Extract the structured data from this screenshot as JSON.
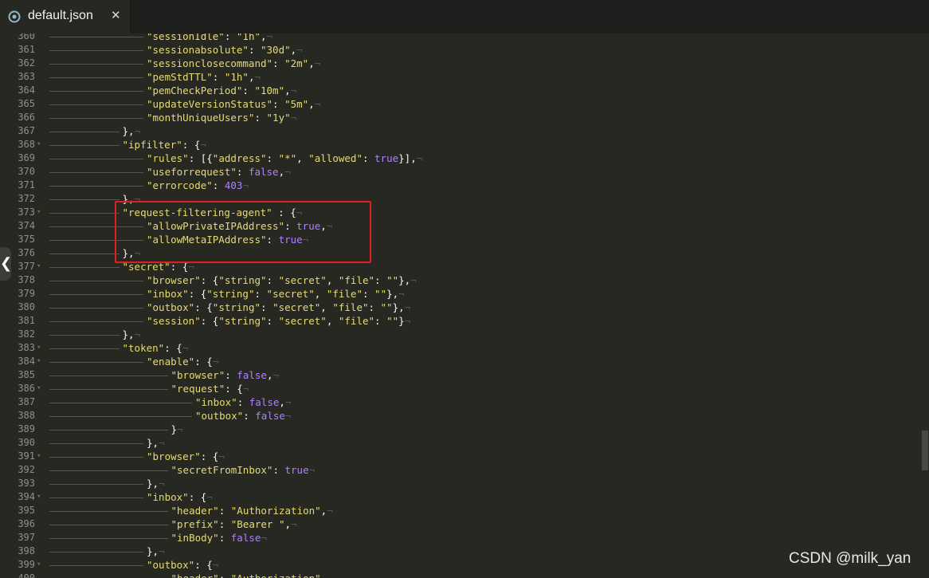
{
  "tab": {
    "title": "default.json",
    "close": "✕",
    "icon": "file-json-icon"
  },
  "collapse_handle": "❮",
  "watermark": "CSDN @milk_yan",
  "colors": {
    "background": "#272822",
    "key": "#e6db74",
    "number_bool": "#ae81ff",
    "punct": "#f8f8f2",
    "line_number": "#8f908a",
    "highlight": "#e02020"
  },
  "lines": [
    {
      "n": "360",
      "fold": false,
      "indent": 4,
      "t": [
        [
          "k",
          "\"sessionIdle\""
        ],
        [
          "p",
          ": "
        ],
        [
          "k",
          "\"1h\""
        ],
        [
          "p",
          ","
        ]
      ]
    },
    {
      "n": "361",
      "fold": false,
      "indent": 4,
      "t": [
        [
          "k",
          "\"sessionabsolute\""
        ],
        [
          "p",
          ": "
        ],
        [
          "k",
          "\"30d\""
        ],
        [
          "p",
          ","
        ]
      ]
    },
    {
      "n": "362",
      "fold": false,
      "indent": 4,
      "t": [
        [
          "k",
          "\"sessionclosecommand\""
        ],
        [
          "p",
          ": "
        ],
        [
          "k",
          "\"2m\""
        ],
        [
          "p",
          ","
        ]
      ]
    },
    {
      "n": "363",
      "fold": false,
      "indent": 4,
      "t": [
        [
          "k",
          "\"pemStdTTL\""
        ],
        [
          "p",
          ": "
        ],
        [
          "k",
          "\"1h\""
        ],
        [
          "p",
          ","
        ]
      ]
    },
    {
      "n": "364",
      "fold": false,
      "indent": 4,
      "t": [
        [
          "k",
          "\"pemCheckPeriod\""
        ],
        [
          "p",
          ": "
        ],
        [
          "k",
          "\"10m\""
        ],
        [
          "p",
          ","
        ]
      ]
    },
    {
      "n": "365",
      "fold": false,
      "indent": 4,
      "t": [
        [
          "k",
          "\"updateVersionStatus\""
        ],
        [
          "p",
          ": "
        ],
        [
          "k",
          "\"5m\""
        ],
        [
          "p",
          ","
        ]
      ]
    },
    {
      "n": "366",
      "fold": false,
      "indent": 4,
      "t": [
        [
          "k",
          "\"monthUniqueUsers\""
        ],
        [
          "p",
          ": "
        ],
        [
          "k",
          "\"1y\""
        ]
      ]
    },
    {
      "n": "367",
      "fold": false,
      "indent": 3,
      "t": [
        [
          "p",
          "},"
        ]
      ]
    },
    {
      "n": "368",
      "fold": true,
      "indent": 3,
      "t": [
        [
          "k",
          "\"ipfilter\""
        ],
        [
          "p",
          ": {"
        ]
      ]
    },
    {
      "n": "369",
      "fold": false,
      "indent": 4,
      "t": [
        [
          "k",
          "\"rules\""
        ],
        [
          "p",
          ": [{"
        ],
        [
          "k",
          "\"address\""
        ],
        [
          "p",
          ": "
        ],
        [
          "k",
          "\"*\""
        ],
        [
          "p",
          ", "
        ],
        [
          "k",
          "\"allowed\""
        ],
        [
          "p",
          ": "
        ],
        [
          "n",
          "true"
        ],
        [
          "p",
          "}],"
        ]
      ]
    },
    {
      "n": "370",
      "fold": false,
      "indent": 4,
      "t": [
        [
          "k",
          "\"useforrequest\""
        ],
        [
          "p",
          ": "
        ],
        [
          "n",
          "false"
        ],
        [
          "p",
          ","
        ]
      ]
    },
    {
      "n": "371",
      "fold": false,
      "indent": 4,
      "t": [
        [
          "k",
          "\"errorcode\""
        ],
        [
          "p",
          ": "
        ],
        [
          "n",
          "403"
        ]
      ]
    },
    {
      "n": "372",
      "fold": false,
      "indent": 3,
      "t": [
        [
          "p",
          "},"
        ]
      ]
    },
    {
      "n": "373",
      "fold": true,
      "indent": 3,
      "t": [
        [
          "k",
          "\"request-filtering-agent\""
        ],
        [
          "p",
          " : {"
        ]
      ]
    },
    {
      "n": "374",
      "fold": false,
      "indent": 4,
      "t": [
        [
          "k",
          "\"allowPrivateIPAddress\""
        ],
        [
          "p",
          ": "
        ],
        [
          "n",
          "true"
        ],
        [
          "p",
          ","
        ]
      ]
    },
    {
      "n": "375",
      "fold": false,
      "indent": 4,
      "t": [
        [
          "k",
          "\"allowMetaIPAddress\""
        ],
        [
          "p",
          ": "
        ],
        [
          "n",
          "true"
        ]
      ]
    },
    {
      "n": "376",
      "fold": false,
      "indent": 3,
      "t": [
        [
          "p",
          "},"
        ]
      ]
    },
    {
      "n": "377",
      "fold": true,
      "indent": 3,
      "t": [
        [
          "k",
          "\"secret\""
        ],
        [
          "p",
          ": {"
        ]
      ]
    },
    {
      "n": "378",
      "fold": false,
      "indent": 4,
      "t": [
        [
          "k",
          "\"browser\""
        ],
        [
          "p",
          ": {"
        ],
        [
          "k",
          "\"string\""
        ],
        [
          "p",
          ": "
        ],
        [
          "k",
          "\"secret\""
        ],
        [
          "p",
          ", "
        ],
        [
          "k",
          "\"file\""
        ],
        [
          "p",
          ": "
        ],
        [
          "k",
          "\"\""
        ],
        [
          "p",
          "},"
        ]
      ]
    },
    {
      "n": "379",
      "fold": false,
      "indent": 4,
      "t": [
        [
          "k",
          "\"inbox\""
        ],
        [
          "p",
          ": {"
        ],
        [
          "k",
          "\"string\""
        ],
        [
          "p",
          ": "
        ],
        [
          "k",
          "\"secret\""
        ],
        [
          "p",
          ", "
        ],
        [
          "k",
          "\"file\""
        ],
        [
          "p",
          ": "
        ],
        [
          "k",
          "\"\""
        ],
        [
          "p",
          "},"
        ]
      ]
    },
    {
      "n": "380",
      "fold": false,
      "indent": 4,
      "t": [
        [
          "k",
          "\"outbox\""
        ],
        [
          "p",
          ": {"
        ],
        [
          "k",
          "\"string\""
        ],
        [
          "p",
          ": "
        ],
        [
          "k",
          "\"secret\""
        ],
        [
          "p",
          ", "
        ],
        [
          "k",
          "\"file\""
        ],
        [
          "p",
          ": "
        ],
        [
          "k",
          "\"\""
        ],
        [
          "p",
          "},"
        ]
      ]
    },
    {
      "n": "381",
      "fold": false,
      "indent": 4,
      "t": [
        [
          "k",
          "\"session\""
        ],
        [
          "p",
          ": {"
        ],
        [
          "k",
          "\"string\""
        ],
        [
          "p",
          ": "
        ],
        [
          "k",
          "\"secret\""
        ],
        [
          "p",
          ", "
        ],
        [
          "k",
          "\"file\""
        ],
        [
          "p",
          ": "
        ],
        [
          "k",
          "\"\""
        ],
        [
          "p",
          "}"
        ]
      ]
    },
    {
      "n": "382",
      "fold": false,
      "indent": 3,
      "t": [
        [
          "p",
          "},"
        ]
      ]
    },
    {
      "n": "383",
      "fold": true,
      "indent": 3,
      "t": [
        [
          "k",
          "\"token\""
        ],
        [
          "p",
          ": {"
        ]
      ]
    },
    {
      "n": "384",
      "fold": true,
      "indent": 4,
      "t": [
        [
          "k",
          "\"enable\""
        ],
        [
          "p",
          ": {"
        ]
      ]
    },
    {
      "n": "385",
      "fold": false,
      "indent": 5,
      "t": [
        [
          "k",
          "\"browser\""
        ],
        [
          "p",
          ": "
        ],
        [
          "n",
          "false"
        ],
        [
          "p",
          ","
        ]
      ]
    },
    {
      "n": "386",
      "fold": true,
      "indent": 5,
      "t": [
        [
          "k",
          "\"request\""
        ],
        [
          "p",
          ": {"
        ]
      ]
    },
    {
      "n": "387",
      "fold": false,
      "indent": 6,
      "t": [
        [
          "k",
          "\"inbox\""
        ],
        [
          "p",
          ": "
        ],
        [
          "n",
          "false"
        ],
        [
          "p",
          ","
        ]
      ]
    },
    {
      "n": "388",
      "fold": false,
      "indent": 6,
      "t": [
        [
          "k",
          "\"outbox\""
        ],
        [
          "p",
          ": "
        ],
        [
          "n",
          "false"
        ]
      ]
    },
    {
      "n": "389",
      "fold": false,
      "indent": 5,
      "t": [
        [
          "p",
          "}"
        ]
      ]
    },
    {
      "n": "390",
      "fold": false,
      "indent": 4,
      "t": [
        [
          "p",
          "},"
        ]
      ]
    },
    {
      "n": "391",
      "fold": true,
      "indent": 4,
      "t": [
        [
          "k",
          "\"browser\""
        ],
        [
          "p",
          ": {"
        ]
      ]
    },
    {
      "n": "392",
      "fold": false,
      "indent": 5,
      "t": [
        [
          "k",
          "\"secretFromInbox\""
        ],
        [
          "p",
          ": "
        ],
        [
          "n",
          "true"
        ]
      ]
    },
    {
      "n": "393",
      "fold": false,
      "indent": 4,
      "t": [
        [
          "p",
          "},"
        ]
      ]
    },
    {
      "n": "394",
      "fold": true,
      "indent": 4,
      "t": [
        [
          "k",
          "\"inbox\""
        ],
        [
          "p",
          ": {"
        ]
      ]
    },
    {
      "n": "395",
      "fold": false,
      "indent": 5,
      "t": [
        [
          "k",
          "\"header\""
        ],
        [
          "p",
          ": "
        ],
        [
          "k",
          "\"Authorization\""
        ],
        [
          "p",
          ","
        ]
      ]
    },
    {
      "n": "396",
      "fold": false,
      "indent": 5,
      "t": [
        [
          "k",
          "\"prefix\""
        ],
        [
          "p",
          ": "
        ],
        [
          "k",
          "\"Bearer \""
        ],
        [
          "p",
          ","
        ]
      ]
    },
    {
      "n": "397",
      "fold": false,
      "indent": 5,
      "t": [
        [
          "k",
          "\"inBody\""
        ],
        [
          "p",
          ": "
        ],
        [
          "n",
          "false"
        ]
      ]
    },
    {
      "n": "398",
      "fold": false,
      "indent": 4,
      "t": [
        [
          "p",
          "},"
        ]
      ]
    },
    {
      "n": "399",
      "fold": true,
      "indent": 4,
      "t": [
        [
          "k",
          "\"outbox\""
        ],
        [
          "p",
          ": {"
        ]
      ]
    },
    {
      "n": "400",
      "fold": false,
      "indent": 5,
      "t": [
        [
          "k",
          "\"header\""
        ],
        [
          "p",
          ": "
        ],
        [
          "k",
          "\"Authorization\""
        ],
        [
          "p",
          ","
        ]
      ]
    }
  ]
}
